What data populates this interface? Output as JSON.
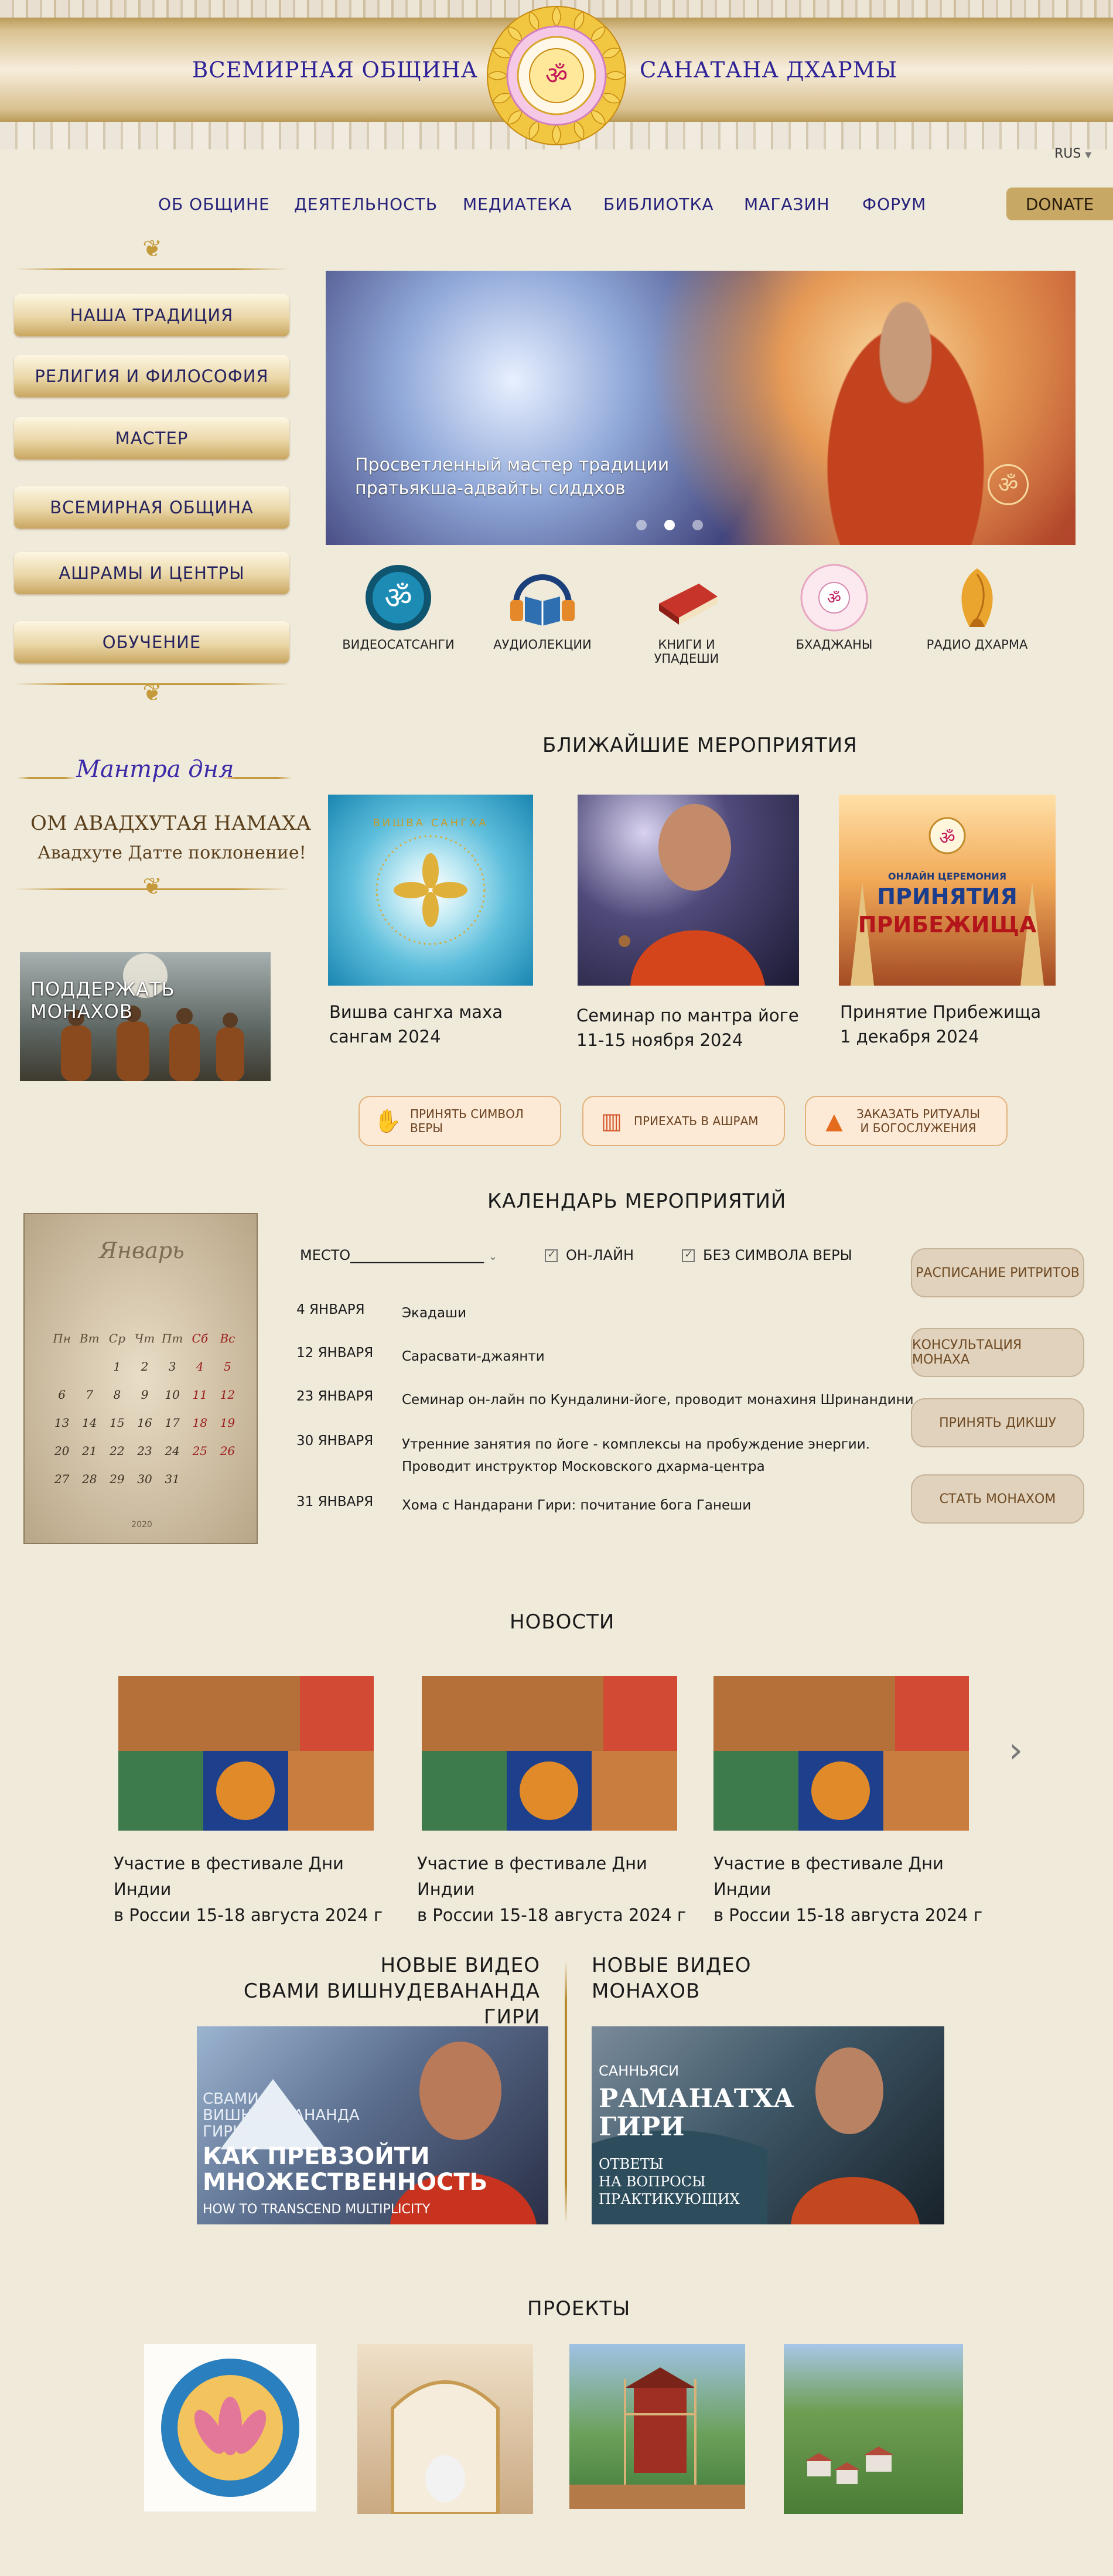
{
  "header": {
    "title_left": "ВСЕМИРНАЯ ОБЩИНА",
    "title_right": "САНАТАНА ДХАРМЫ",
    "language": "RUS"
  },
  "nav": {
    "items": [
      "ОБ ОБЩИНЕ",
      "ДЕЯТЕЛЬНОСТЬ",
      "МЕДИАТЕКА",
      "БИБЛИОТКА",
      "МАГАЗИН",
      "ФОРУМ"
    ],
    "donate": "DONATE"
  },
  "sidebar": {
    "items": [
      "НАША ТРАДИЦИЯ",
      "РЕЛИГИЯ И ФИЛОСОФИЯ",
      "МАСТЕР",
      "ВСЕМИРНАЯ ОБЩИНА",
      "АШРАМЫ И ЦЕНТРЫ",
      "ОБУЧЕНИЕ"
    ],
    "mantra_title": "Мантра дня",
    "mantra_main": "ОМ АВАДХУТАЯ НАМАХА",
    "mantra_sub": "Авадхуте Датте поклонение!",
    "support": "ПОДДЕРЖАТЬ МОНАХОВ"
  },
  "hero": {
    "line1": "Просветленный мастер традиции",
    "line2": "пратьякша-адвайты сиддхов",
    "slides": 3,
    "active_slide": 2
  },
  "quick_links": [
    "ВИДЕОСАТСАНГИ",
    "АУДИОЛЕКЦИИ",
    "КНИГИ И УПАДЕШИ",
    "БХАДЖАНЫ",
    "РАДИО ДХАРМА"
  ],
  "events": {
    "heading": "БЛИЖАЙШИЕ МЕРОПРИЯТИЯ",
    "items": [
      {
        "line1": "Вишва сангха маха",
        "line2": "сангам 2024",
        "img_text": "ВИШВА САНГХА"
      },
      {
        "line1": "Семинар по мантра йоге",
        "line2": "11-15 ноября 2024"
      },
      {
        "line1": "Принятие Прибежища",
        "line2": "1 декабря 2024",
        "img_small": "ОНЛАЙН ЦЕРЕМОНИЯ",
        "img_big1": "ПРИНЯТИЯ",
        "img_big2": "ПРИБЕЖИЩА"
      }
    ],
    "pills": [
      {
        "label": "ПРИНЯТЬ СИМВОЛ ВЕРЫ"
      },
      {
        "label": "ПРИЕХАТЬ В АШРАМ"
      },
      {
        "label1": "ЗАКАЗАТЬ РИТУАЛЫ",
        "label2": "И БОГОСЛУЖЕНИЯ"
      }
    ]
  },
  "calendar": {
    "heading": "КАЛЕНДАРЬ МЕРОПРИЯТИЙ",
    "month": "Январь",
    "year": "2020",
    "weekdays": [
      "Пн",
      "Вт",
      "Ср",
      "Чт",
      "Пт",
      "Сб",
      "Вс"
    ],
    "filter_place": "МЕСТО___________________",
    "filter_online": "ОН-ЛАЙН",
    "filter_no_symbol": "БЕЗ СИМВОЛА ВЕРЫ",
    "rows": [
      {
        "date": "4 ЯНВАРЯ",
        "desc": "Экадаши"
      },
      {
        "date": "12 ЯНВАРЯ",
        "desc": "Сарасвати-джаянти"
      },
      {
        "date": "23 ЯНВАРЯ",
        "desc": "Семинар он-лайн по Кундалини-йоге, проводит монахиня Шринандини"
      },
      {
        "date": "30 ЯНВАРЯ",
        "desc": "Утренние занятия по йоге - комплексы на пробуждение энергии.",
        "desc2": "Проводит инструктор Московского дхарма-центра"
      },
      {
        "date": "31 ЯНВАРЯ",
        "desc": "Хома с Нандарани Гири: почитание бога Ганеши"
      }
    ],
    "buttons": [
      "РАСПИСАНИЕ РИТРИТОВ",
      "КОНСУЛЬТАЦИЯ МОНАХА",
      "ПРИНЯТЬ ДИКШУ",
      "СТАТЬ МОНАХОМ"
    ]
  },
  "news": {
    "heading": "НОВОСТИ",
    "items": [
      {
        "line1": "Участие в фестивале Дни Индии",
        "line2": "в России 15-18 августа 2024 г"
      },
      {
        "line1": "Участие в фестивале Дни Индии",
        "line2": "в России 15-18 августа 2024 г"
      },
      {
        "line1": "Участие в фестивале Дни Индии",
        "line2": "в России 15-18 августа 2024 г"
      }
    ]
  },
  "videos": {
    "left_h1": "НОВЫЕ ВИДЕО",
    "left_h2": "СВАМИ ВИШНУДЕВАНАНДА ГИРИ",
    "right_h1": "НОВЫЕ ВИДЕО",
    "right_h2": "МОНАХОВ",
    "left_thumb": {
      "small1": "СВАМИ",
      "small2": "ВИШНУДЕВАНАНДА",
      "small3": "ГИРИ",
      "big1": "КАК ПРЕВЗОЙТИ",
      "big2": "МНОЖЕСТВЕННОСТЬ",
      "en": "HOW TO TRANSCEND MULTIPLICITY"
    },
    "right_thumb": {
      "small": "САННЬЯСИ",
      "big1": "РАМАНАТХА",
      "big2": "ГИРИ",
      "sub1": "ОТВЕТЫ",
      "sub2": "НА ВОПРОСЫ",
      "sub3": "ПРАКТИКУЮЩИХ"
    }
  },
  "projects": {
    "heading": "ПРОЕКТЫ"
  }
}
